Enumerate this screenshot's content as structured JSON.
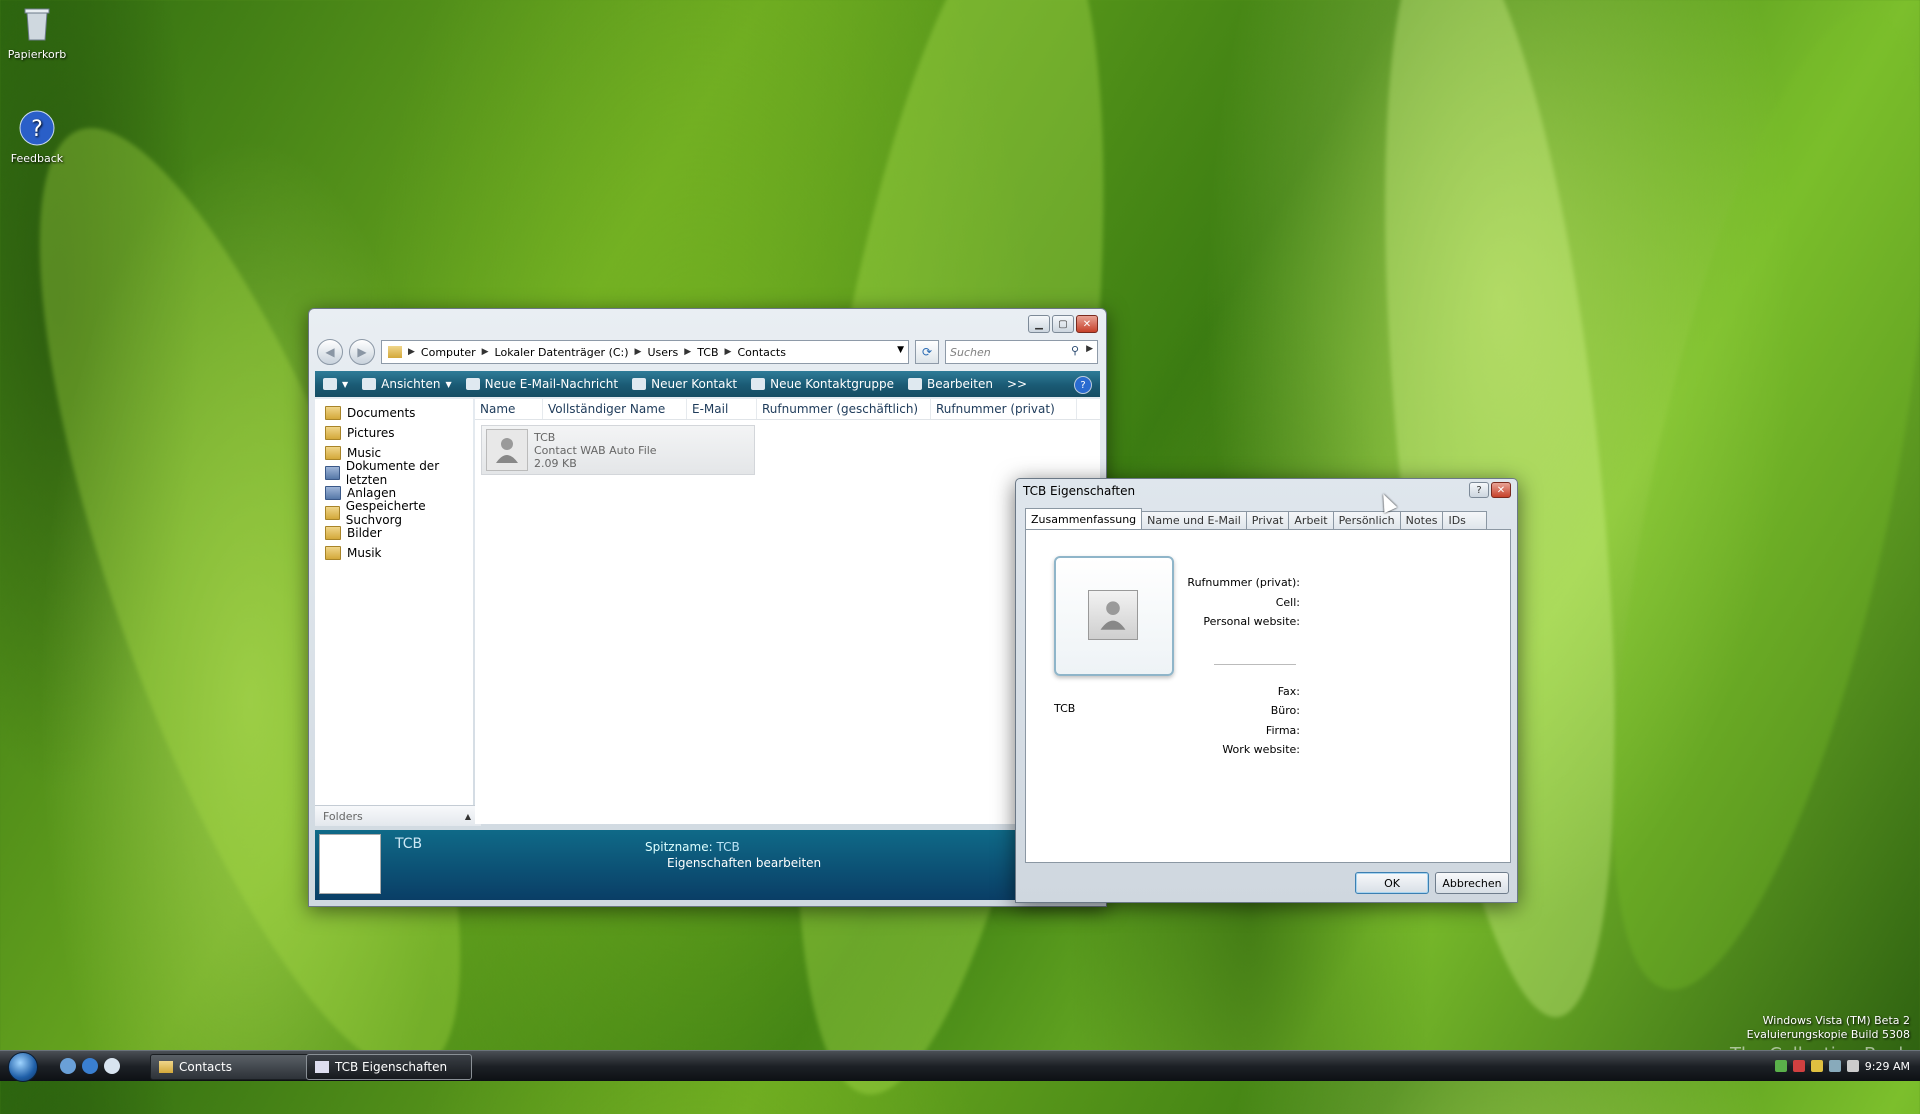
{
  "desktop": {
    "icons": [
      {
        "label": "Papierkorb",
        "icon": "recycle-bin-icon"
      },
      {
        "label": "Feedback",
        "icon": "help-feedback-icon"
      }
    ],
    "watermark": {
      "line1": "Windows Vista (TM) Beta 2",
      "line2": "Evaluierungskopie Build 5308"
    },
    "overlay_text": "The Collection Book"
  },
  "explorer": {
    "address": {
      "crumbs": [
        "Computer",
        "Lokaler Datenträger (C:)",
        "Users",
        "TCB",
        "Contacts"
      ]
    },
    "search": {
      "placeholder": "Suchen"
    },
    "toolbar": {
      "views": "Ansichten",
      "new_email": "Neue E-Mail-Nachricht",
      "new_contact": "Neuer Kontakt",
      "new_group": "Neue Kontaktgruppe",
      "edit": "Bearbeiten",
      "more": ">>",
      "help": "?"
    },
    "nav_items": [
      "Documents",
      "Pictures",
      "Music",
      "Dokumente der letzten",
      "Anlagen",
      "Gespeicherte Suchvorg",
      "Bilder",
      "Musik"
    ],
    "folders_label": "Folders",
    "columns": [
      "Name",
      "Vollständiger Name",
      "E-Mail",
      "Rufnummer (geschäftlich)",
      "Rufnummer (privat)"
    ],
    "file": {
      "name": "TCB",
      "type": "Contact WAB Auto File",
      "size": "2.09 KB"
    },
    "details": {
      "name": "TCB",
      "nickname_label": "Spitzname:",
      "nickname_value": "TCB",
      "edit_link": "Eigenschaften bearbeiten"
    }
  },
  "dialog": {
    "title": "TCB Eigenschaften",
    "help_btn": "?",
    "tabs": [
      "Zusammenfassung",
      "Name und E-Mail",
      "Privat",
      "Arbeit",
      "Persönlich",
      "Notes",
      "IDs"
    ],
    "contact_name": "TCB",
    "fields": {
      "phone_private": "Rufnummer (privat):",
      "cell": "Cell:",
      "personal_website": "Personal website:",
      "fax": "Fax:",
      "office": "Büro:",
      "company": "Firma:",
      "work_website": "Work website:"
    },
    "ok": "OK",
    "cancel": "Abbrechen"
  },
  "taskbar": {
    "tasks": [
      "Contacts",
      "TCB Eigenschaften"
    ],
    "clock": "9:29 AM"
  }
}
